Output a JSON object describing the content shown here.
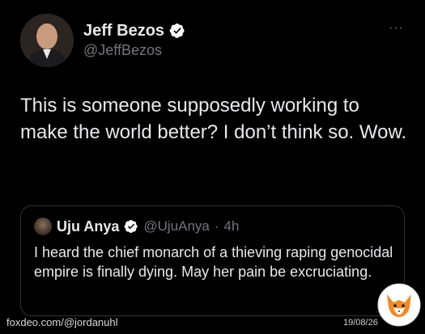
{
  "author": {
    "display_name": "Jeff Bezos",
    "handle": "@JeffBezos",
    "verified_icon": "verified-badge-icon"
  },
  "tweet": {
    "text": "This is someone supposedly working to make the world better? I don’t think so. Wow."
  },
  "more_menu": "···",
  "quote": {
    "display_name": "Uju Anya",
    "handle": "@UjuAnya",
    "separator": "·",
    "time": "4h",
    "text": "I heard the chief monarch of a thieving raping genocidal empire is finally dying. May her pain be excruciating."
  },
  "watermark": {
    "source": "foxdeo.com/@jordanuhl",
    "date": "19/08/26",
    "logo_icon": "fox-logo-icon"
  },
  "colors": {
    "background": "#000000",
    "text": "#e7e9ea",
    "secondary": "#71767b",
    "verified": "#ffffff"
  }
}
